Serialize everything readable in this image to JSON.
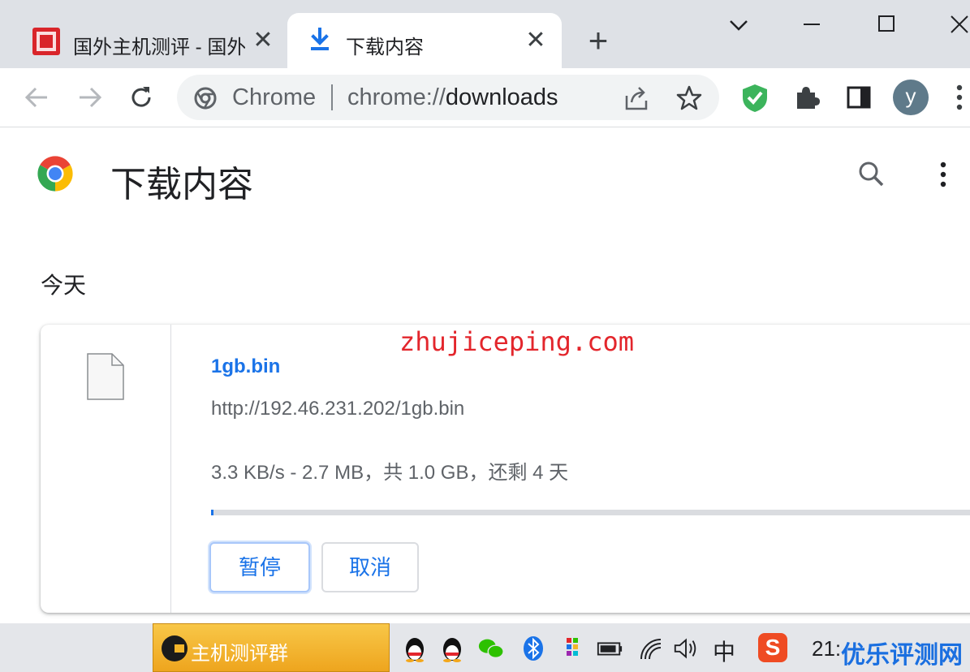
{
  "tabs": [
    {
      "title": "国外主机测评 - 国外",
      "close": "✕"
    },
    {
      "title": "下载内容",
      "close": "✕"
    }
  ],
  "new_tab": "+",
  "omnibox": {
    "chip": "Chrome",
    "url_scheme": "chrome://",
    "url_path": "downloads"
  },
  "avatar_letter": "y",
  "page": {
    "title": "下载内容",
    "section": "今天"
  },
  "watermark": "zhujiceping.com",
  "download": {
    "filename": "1gb.bin",
    "url": "http://192.46.231.202/1gb.bin",
    "status": "3.3 KB/s - 2.7 MB，共 1.0 GB，还剩 4 天",
    "progress": 0.0027,
    "pause_label": "暂停",
    "cancel_label": "取消"
  },
  "taskbar": {
    "app_label": "主机测评群",
    "ime": "中",
    "clock": "21:",
    "brand_watermark": "优乐评测网"
  },
  "colors": {
    "accent": "#1a73e8",
    "watermark": "#e3262c",
    "brand": "#1a6fe0",
    "taskbar_app": "#f3b52a"
  }
}
